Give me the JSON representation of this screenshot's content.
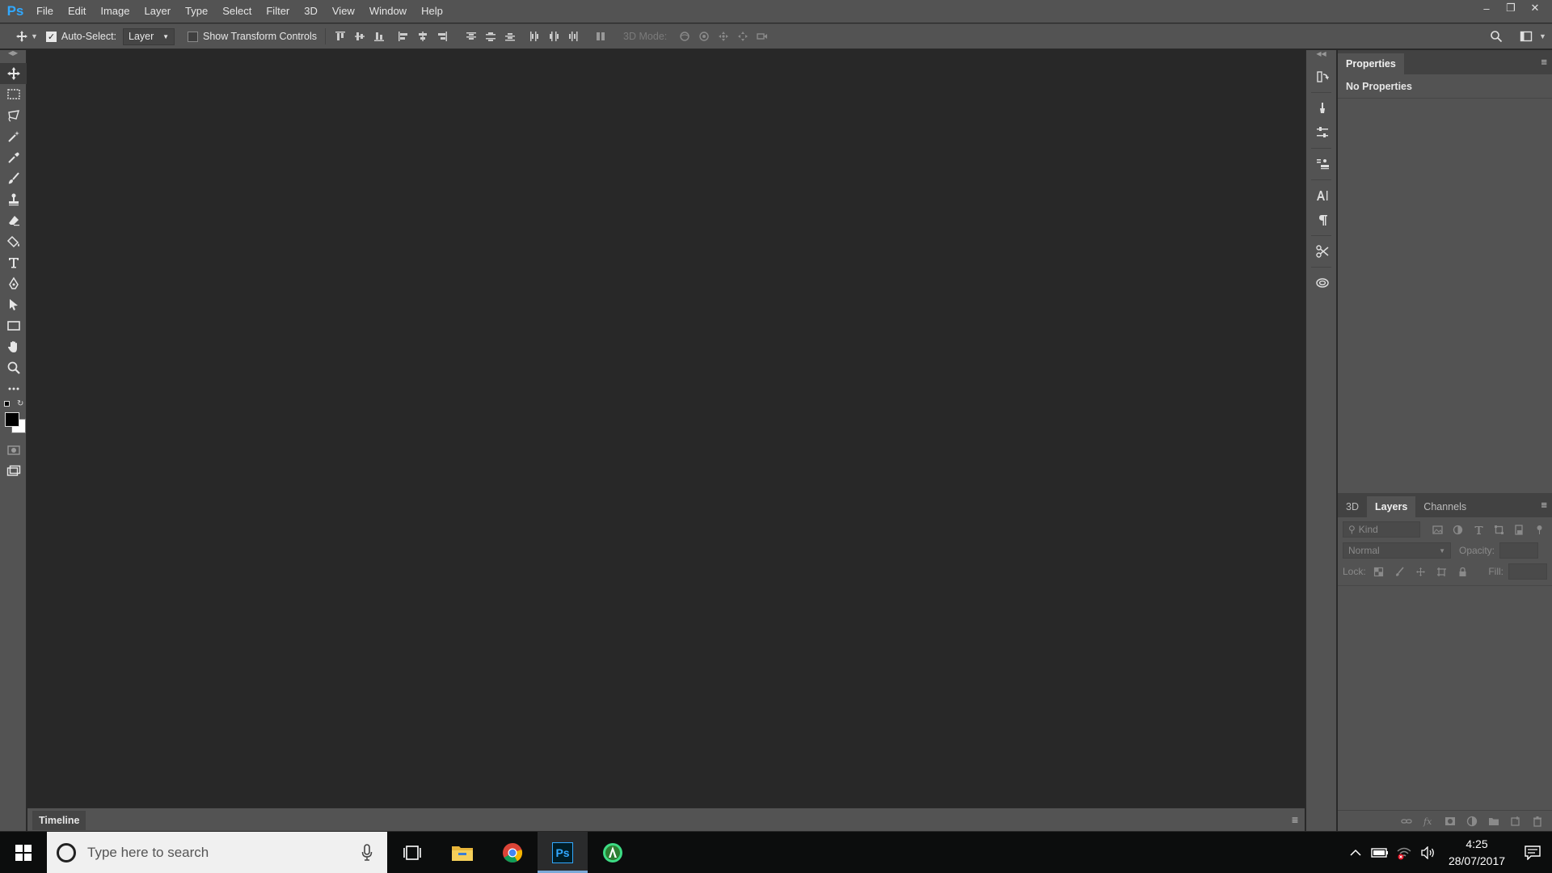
{
  "app": {
    "logo_text": "Ps"
  },
  "menubar": {
    "items": [
      "File",
      "Edit",
      "Image",
      "Layer",
      "Type",
      "Select",
      "Filter",
      "3D",
      "View",
      "Window",
      "Help"
    ],
    "window_controls": [
      "minimize",
      "restore",
      "close"
    ]
  },
  "options_bar": {
    "auto_select_label": "Auto-Select:",
    "auto_select_checked": true,
    "auto_select_target": "Layer",
    "transform_label": "Show Transform Controls",
    "transform_checked": false,
    "mode3d_label": "3D Mode:"
  },
  "tools": [
    "move-tool",
    "marquee-tool",
    "lasso-tool",
    "magic-wand-tool",
    "eyedropper-tool",
    "brush-tool",
    "clone-stamp-tool",
    "eraser-tool",
    "paint-bucket-tool",
    "type-tool",
    "pen-tool",
    "path-selection-tool",
    "rectangle-tool",
    "hand-tool",
    "zoom-tool",
    "more-tools"
  ],
  "colors": {
    "foreground": "#000000",
    "background": "#ffffff",
    "accent": "#31a8ff"
  },
  "timeline": {
    "tab_label": "Timeline"
  },
  "properties_panel": {
    "tab_label": "Properties",
    "body_text": "No Properties"
  },
  "layers_panel": {
    "tabs": [
      "3D",
      "Layers",
      "Channels"
    ],
    "active_tab": "Layers",
    "filter_placeholder": "Kind",
    "blend_mode": "Normal",
    "opacity_label": "Opacity:",
    "lock_label": "Lock:",
    "fill_label": "Fill:"
  },
  "taskbar": {
    "search_placeholder": "Type here to search",
    "apps": [
      "task-view",
      "file-explorer",
      "chrome",
      "photoshop",
      "android-studio"
    ],
    "active_app": "photoshop",
    "clock_time": "4:25",
    "clock_date": "28/07/2017"
  }
}
